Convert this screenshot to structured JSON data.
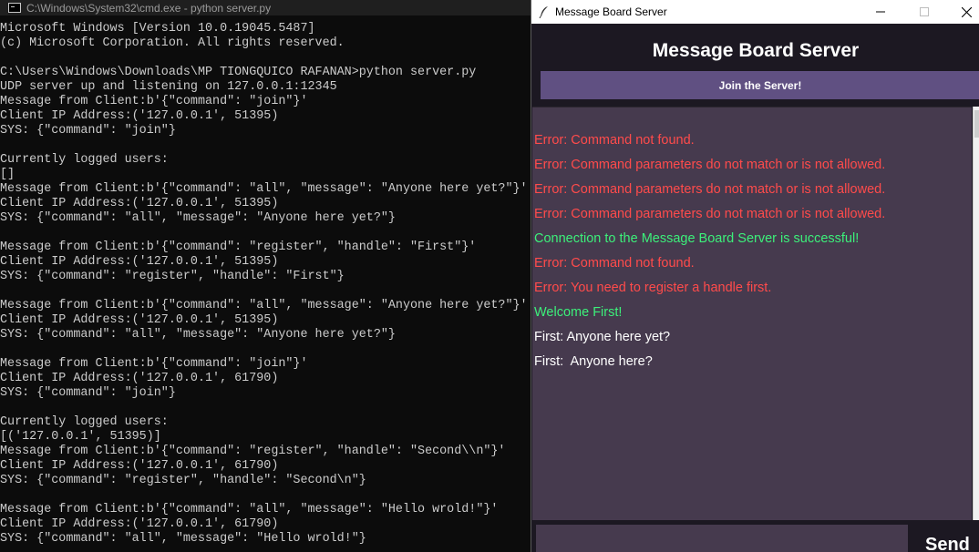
{
  "cmd": {
    "title": "C:\\Windows\\System32\\cmd.exe - python  server.py",
    "lines": [
      "Microsoft Windows [Version 10.0.19045.5487]",
      "(c) Microsoft Corporation. All rights reserved.",
      "",
      "C:\\Users\\Windows\\Downloads\\MP TIONGQUICO RAFANAN>python server.py",
      "UDP server up and listening on 127.0.0.1:12345",
      "Message from Client:b'{\"command\": \"join\"}'",
      "Client IP Address:('127.0.0.1', 51395)",
      "SYS: {\"command\": \"join\"}",
      "",
      "Currently logged users:",
      "[]",
      "Message from Client:b'{\"command\": \"all\", \"message\": \"Anyone here yet?\"}'",
      "Client IP Address:('127.0.0.1', 51395)",
      "SYS: {\"command\": \"all\", \"message\": \"Anyone here yet?\"}",
      "",
      "Message from Client:b'{\"command\": \"register\", \"handle\": \"First\"}'",
      "Client IP Address:('127.0.0.1', 51395)",
      "SYS: {\"command\": \"register\", \"handle\": \"First\"}",
      "",
      "Message from Client:b'{\"command\": \"all\", \"message\": \"Anyone here yet?\"}'",
      "Client IP Address:('127.0.0.1', 51395)",
      "SYS: {\"command\": \"all\", \"message\": \"Anyone here yet?\"}",
      "",
      "Message from Client:b'{\"command\": \"join\"}'",
      "Client IP Address:('127.0.0.1', 61790)",
      "SYS: {\"command\": \"join\"}",
      "",
      "Currently logged users:",
      "[('127.0.0.1', 51395)]",
      "Message from Client:b'{\"command\": \"register\", \"handle\": \"Second\\\\n\"}'",
      "Client IP Address:('127.0.0.1', 61790)",
      "SYS: {\"command\": \"register\", \"handle\": \"Second\\n\"}",
      "",
      "Message from Client:b'{\"command\": \"all\", \"message\": \"Hello wrold!\"}'",
      "Client IP Address:('127.0.0.1', 61790)",
      "SYS: {\"command\": \"all\", \"message\": \"Hello wrold!\"}"
    ]
  },
  "board": {
    "window_title": "Message Board Server",
    "header": "Message Board Server",
    "join_label": "Join the Server!",
    "send_label": "Send",
    "input_value": "",
    "messages": [
      {
        "text": "Error: Command not found.",
        "color": "#ff4b4b"
      },
      {
        "text": "Error: Command parameters do not match or is not allowed.",
        "color": "#ff4b4b"
      },
      {
        "text": "Error: Command parameters do not match or is not allowed.",
        "color": "#ff4b4b"
      },
      {
        "text": "Error: Command parameters do not match or is not allowed.",
        "color": "#ff4b4b"
      },
      {
        "text": "Connection to the Message Board Server is successful!",
        "color": "#3cf07a"
      },
      {
        "text": "Error: Command not found.",
        "color": "#ff4b4b"
      },
      {
        "text": "Error: You need to register a handle first.",
        "color": "#ff4b4b"
      },
      {
        "text": "Welcome First!",
        "color": "#3cf07a"
      },
      {
        "text": "First: Anyone here yet?",
        "color": "#ffffff"
      },
      {
        "text": "First:  Anyone here?",
        "color": "#ffffff"
      }
    ]
  },
  "icons": {
    "cmd_icon": "console-icon",
    "app_icon": "feather-icon",
    "minimize": "minimize-icon",
    "maximize": "maximize-icon",
    "close": "close-icon"
  }
}
